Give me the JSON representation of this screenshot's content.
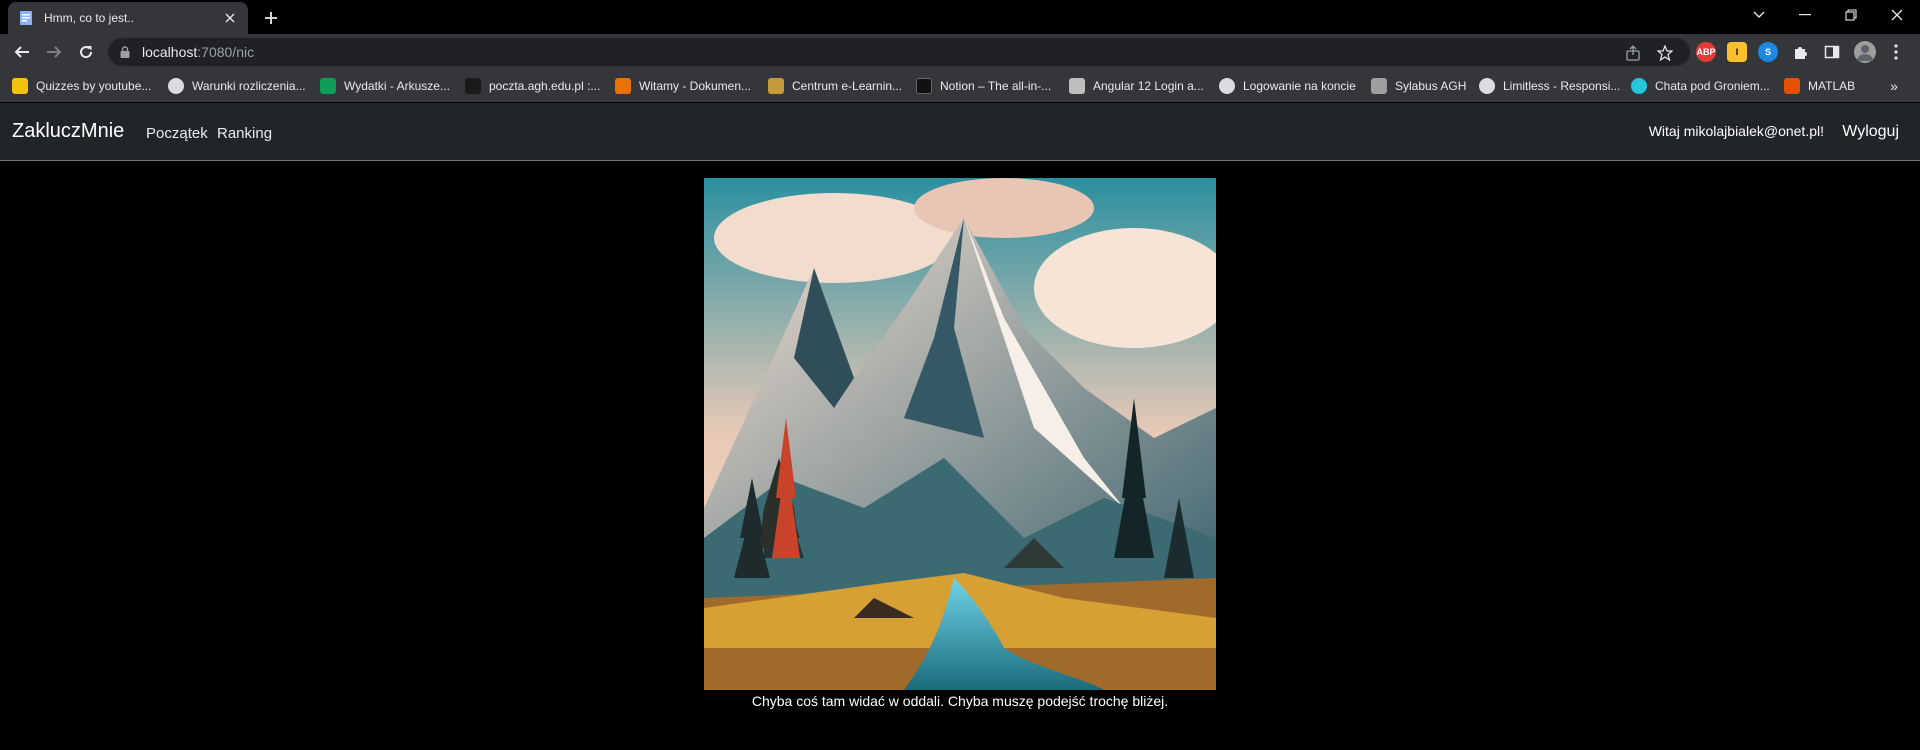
{
  "browser": {
    "tab_title": "Hmm, co to jest..",
    "url_host": "localhost",
    "url_rest": ":7080/nic"
  },
  "bookmarks": [
    {
      "label": "Quizzes by youtube...",
      "icon_color": "#f4c20d"
    },
    {
      "label": "Warunki rozliczenia...",
      "icon_color": "#dadce0"
    },
    {
      "label": "Wydatki - Arkusze...",
      "icon_color": "#0f9d58"
    },
    {
      "label": "poczta.agh.edu.pl :...",
      "icon_color": "#1a1a1a"
    },
    {
      "label": "Witamy - Dokumen...",
      "icon_color": "#e8710a"
    },
    {
      "label": "Centrum e-Learnin...",
      "icon_color": "#c49a3a"
    },
    {
      "label": "Notion – The all-in-...",
      "icon_color": "#111111"
    },
    {
      "label": "Angular 12 Login a...",
      "icon_color": "#bdbdbd"
    },
    {
      "label": "Logowanie na koncie",
      "icon_color": "#dadce0"
    },
    {
      "label": "Sylabus AGH",
      "icon_color": "#9e9e9e"
    },
    {
      "label": "Limitless - Responsi...",
      "icon_color": "#dadce0"
    },
    {
      "label": "Chata pod Groniem...",
      "icon_color": "#26c6da"
    },
    {
      "label": "MATLAB",
      "icon_color": "#e65100"
    }
  ],
  "app": {
    "brand": "ZakluczMnie",
    "nav": [
      "Początek",
      "Ranking"
    ],
    "greeting": "Witaj mikolajbialek@onet.pl!",
    "logout": "Wyloguj"
  },
  "content": {
    "caption": "Chyba coś tam widać w oddali. Chyba muszę podejść trochę bliżej."
  },
  "colors": {
    "navbar_bg": "#212529",
    "page_bg": "#000000",
    "chrome_bg": "#35363a"
  }
}
